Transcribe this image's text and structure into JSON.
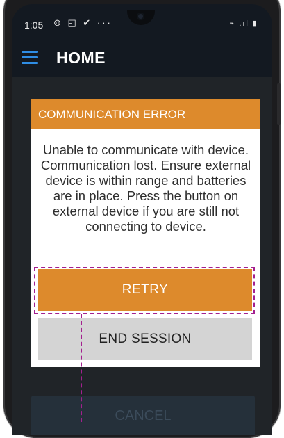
{
  "status_bar": {
    "time": "1:05",
    "left_icons": "⊚ ◰ ✔ ···",
    "right_icons": "⌁ .ıl ▮"
  },
  "app_bar": {
    "title": "HOME",
    "menu_icon": "hamburger-menu-icon",
    "accent_color": "#2f8de4"
  },
  "dialog": {
    "title": "COMMUNICATION ERROR",
    "message": "Unable to communicate with device. Communication lost. Ensure external device is within range and batteries are in place. Press the button on external device if you are still not connecting to device.",
    "retry_label": "RETRY",
    "end_session_label": "END SESSION",
    "header_color": "#dd8a2c"
  },
  "background": {
    "cancel_label": "CANCEL"
  },
  "annotation": {
    "highlight_color": "#a3208f"
  }
}
